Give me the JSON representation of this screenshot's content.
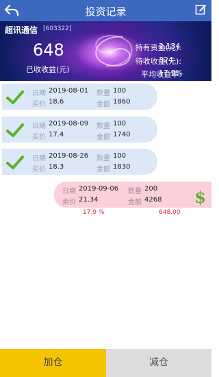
{
  "header": {
    "title": "投资记录"
  },
  "stock": {
    "name": "超讯通信",
    "code": "[603322]"
  },
  "summary": {
    "income_value": "648",
    "income_label": "已收收益(元)",
    "stats": [
      {
        "label": "持有资金(元):",
        "value": "2,134"
      },
      {
        "label": "待收收益(元):",
        "value": "324"
      },
      {
        "label": "平均收益率:",
        "value": "17.9%"
      }
    ]
  },
  "field_labels": {
    "date": "日期",
    "qty": "数量",
    "price": "买价",
    "amount": "金额",
    "sell_price": "卖价"
  },
  "buys": [
    {
      "date": "2019-08-01",
      "qty": "100",
      "price": "18.6",
      "amount": "1860"
    },
    {
      "date": "2019-08-09",
      "qty": "100",
      "price": "17.4",
      "amount": "1740"
    },
    {
      "date": "2019-08-26",
      "qty": "100",
      "price": "18.3",
      "amount": "1830"
    }
  ],
  "sell": {
    "date": "2019-09-06",
    "qty": "200",
    "price": "21.34",
    "amount": "4268",
    "rate": "17.9 %",
    "profit": "648.00"
  },
  "actions": {
    "add": "加仓",
    "reduce": "减仓"
  },
  "colors": {
    "header": "#3d68c0",
    "buy_card": "#dce7f7",
    "sell_card": "#fbd0da",
    "add_button": "#f5c400",
    "reduce_button": "#dcdcdc",
    "profit": "#e03030",
    "check": "#5cb130"
  }
}
